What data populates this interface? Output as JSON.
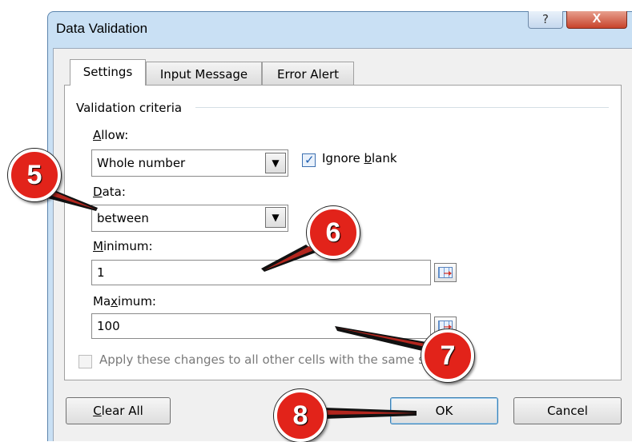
{
  "window": {
    "title": "Data Validation",
    "help_glyph": "?",
    "close_glyph": "X"
  },
  "tabs": [
    {
      "label": "Settings",
      "active": true
    },
    {
      "label": "Input Message",
      "active": false
    },
    {
      "label": "Error Alert",
      "active": false
    }
  ],
  "settings": {
    "section_title": "Validation criteria",
    "allow": {
      "label_key": "A",
      "label_rest": "llow:",
      "value": "Whole number"
    },
    "ignore_blank": {
      "label_pre": "Ignore ",
      "label_key": "b",
      "label_rest": "lank",
      "checked": true
    },
    "data": {
      "label_key": "D",
      "label_rest": "ata:",
      "value": "between"
    },
    "minimum": {
      "label_key": "M",
      "label_rest": "inimum:",
      "value": "1"
    },
    "maximum": {
      "label_pre": "Ma",
      "label_key": "x",
      "label_rest": "imum:",
      "value": "100"
    },
    "apply_all": {
      "label": "Apply these changes to all other cells with the same settings",
      "checked": false
    }
  },
  "footer": {
    "clear_all_key": "C",
    "clear_all_rest": "lear All",
    "ok": "OK",
    "cancel": "Cancel"
  },
  "callouts": [
    "5",
    "6",
    "7",
    "8"
  ],
  "colors": {
    "callout_red": "#e2231a",
    "frame_blue": "#c9e0f4",
    "close_red": "#c8432b"
  },
  "icons": {
    "dropdown": "chevron-down-icon",
    "range_selector": "collapse-dialog-icon",
    "check": "checkmark-icon"
  }
}
